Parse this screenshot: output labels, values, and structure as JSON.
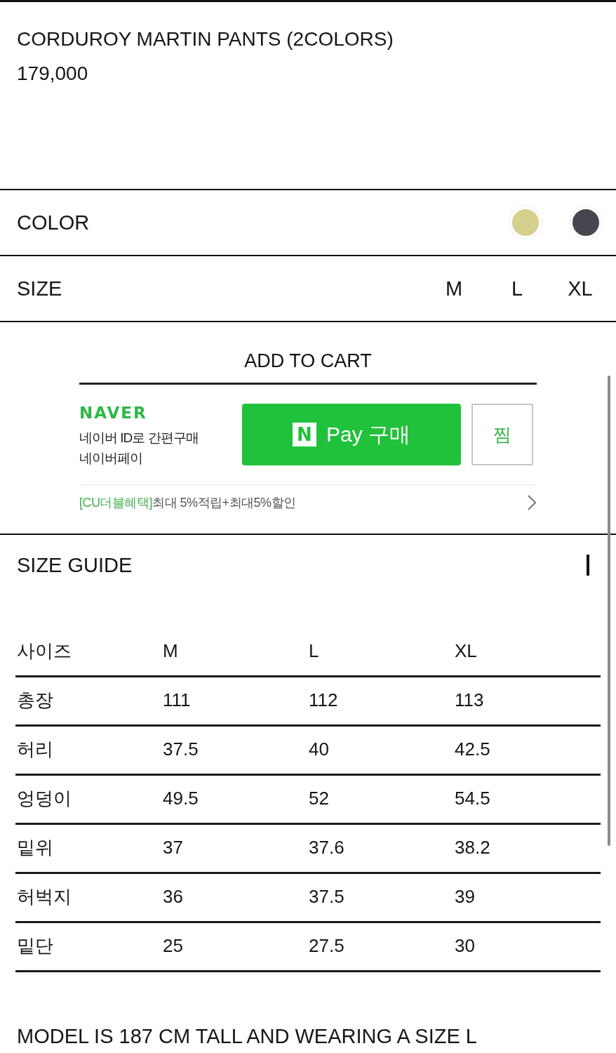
{
  "product": {
    "title": "CORDUROY MARTIN PANTS (2COLORS)",
    "price": "179,000"
  },
  "color_option": {
    "label": "COLOR",
    "swatches": [
      {
        "color": "#d5d08c",
        "selected": false
      },
      {
        "color": "#46474e",
        "selected": false
      }
    ]
  },
  "size_option": {
    "label": "SIZE",
    "choices": [
      {
        "label": "M",
        "selected": false
      },
      {
        "label": "L",
        "selected": false
      },
      {
        "label": "XL",
        "selected": false
      }
    ]
  },
  "cart": {
    "button": "ADD TO CART"
  },
  "naver_pay": {
    "logo": "NAVER",
    "lines": [
      "네이버 ID로 간편구매",
      "네이버페이"
    ],
    "pay_button": {
      "badge": "N",
      "label": "Pay 구매"
    },
    "wish_button": "찜",
    "promo": {
      "tag": "[CU더블혜택]",
      "text": "최대 5%적립+최대5%할인"
    }
  },
  "size_guide": {
    "title": "SIZE GUIDE",
    "table": {
      "columns": [
        "사이즈",
        "M",
        "L",
        "XL"
      ],
      "rows": [
        [
          "총장",
          "111",
          "112",
          "113"
        ],
        [
          "허리",
          "37.5",
          "40",
          "42.5"
        ],
        [
          "엉덩이",
          "49.5",
          "52",
          "54.5"
        ],
        [
          "밑위",
          "37",
          "37.6",
          "38.2"
        ],
        [
          "허벅지",
          "36",
          "37.5",
          "39"
        ],
        [
          "밑단",
          "25",
          "27.5",
          "30"
        ]
      ]
    }
  },
  "note": "MODEL IS 187 CM TALL AND WEARING A SIZE L"
}
